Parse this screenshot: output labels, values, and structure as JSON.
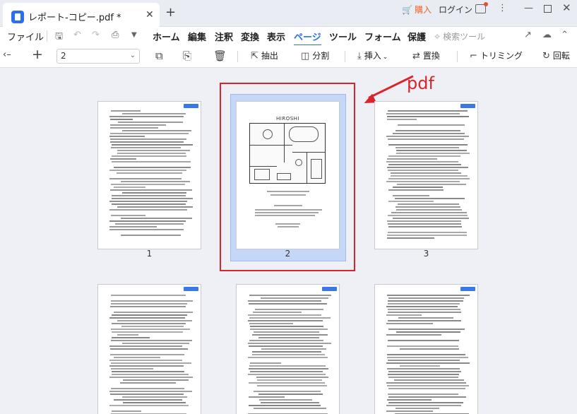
{
  "window": {
    "tab_title": "レポート-コピー.pdf *",
    "tab_close_glyph": "✕",
    "tab_add_glyph": "+",
    "buy_label": "購入",
    "login_label": "ログイン"
  },
  "menubar": {
    "file_label": "ファイル",
    "items": [
      "ホーム",
      "編集",
      "注釈",
      "変換",
      "表示",
      "ページ",
      "ツール",
      "フォーム",
      "保護"
    ],
    "active_item": "ページ",
    "search_tools_label": "検索ツール"
  },
  "toolbar": {
    "page_select_value": "2",
    "extract_label": "抽出",
    "split_label": "分割",
    "insert_label": "挿入",
    "replace_label": "置換",
    "crop_label": "トリミング",
    "rotate_label": "回転"
  },
  "pages": {
    "labels": [
      "1",
      "2",
      "3"
    ],
    "selected": "2",
    "plan_title": "HIROSHI"
  },
  "annotation": {
    "label": "pdf",
    "color": "#d9242a"
  },
  "colors": {
    "accent": "#2b6ef0",
    "buy": "#f0652b",
    "selection": "#c5d7f7"
  }
}
